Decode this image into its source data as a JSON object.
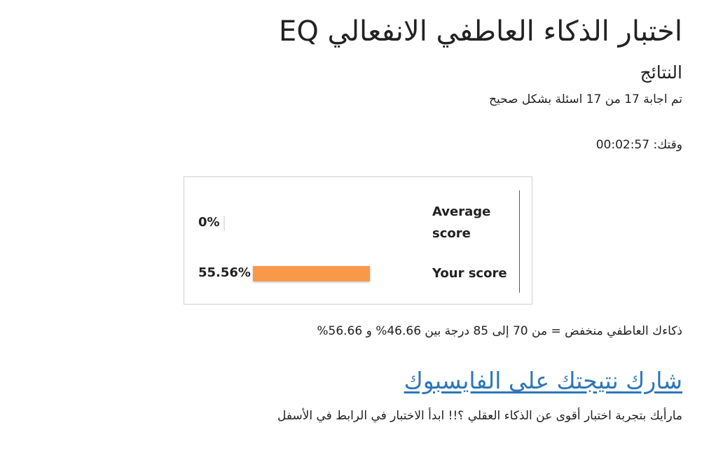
{
  "header": {
    "title": "اختبار الذكاء العاطفي الانفعالي EQ",
    "subtitle": "النتائج"
  },
  "results": {
    "correct_text": "تم اجابة 17 من 17 اسئلة بشكل صحيح",
    "time_label": "وقتك:",
    "time_value": "00:02:57"
  },
  "score_box": {
    "rows": [
      {
        "label_line1": "Average",
        "label_line2": "score",
        "percent_text": "0%",
        "percent_value": 0,
        "bar_color": "#e3e3e3"
      },
      {
        "label": "Your score",
        "percent_text": "55.56%",
        "percent_value": 55.56,
        "bar_color": "#f8994a"
      }
    ]
  },
  "interpretation": {
    "text": "ذكاءك العاطفي منخفض = من 70 إلى 85 درجة بين 46.66% و 56.66%"
  },
  "share": {
    "label": "شارك نتيجتك على الفايسبوك",
    "link_color": "#2d76b9"
  },
  "cta": {
    "text": "مارأيك بتجربة اختبار أقوى عن الذكاء العقلي ؟!! ابدأ الاختبار في الرابط في الأسفل"
  }
}
